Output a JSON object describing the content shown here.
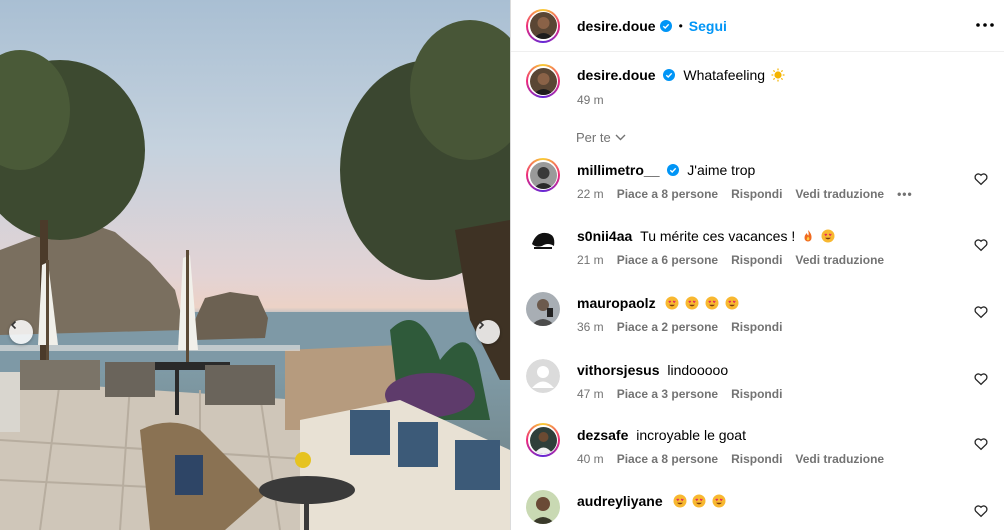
{
  "post": {
    "author": "desire.doue",
    "follow_label": "Segui",
    "separator": "•",
    "caption_text": "Whatafeeling",
    "caption_emoji": "sun-icon",
    "caption_time": "49 m"
  },
  "filter_label": "Per te",
  "actions": {
    "reply": "Rispondi",
    "translate": "Vedi traduzione",
    "more": "•••"
  },
  "comments": [
    {
      "user": "millimetro__",
      "verified": true,
      "text": "J'aime trop",
      "emojis": [],
      "time": "22 m",
      "likes": "Piace a 8 persone",
      "translate": true,
      "more": true
    },
    {
      "user": "s0nii4aa",
      "verified": false,
      "text": "Tu mérite ces vacances !",
      "emojis": [
        "fire-icon",
        "heart-eyes-icon"
      ],
      "time": "21 m",
      "likes": "Piace a 6 persone",
      "translate": true,
      "more": false
    },
    {
      "user": "mauropaolz",
      "verified": false,
      "text": "",
      "emojis": [
        "heart-eyes-icon",
        "heart-eyes-icon",
        "heart-eyes-icon",
        "heart-eyes-icon"
      ],
      "time": "36 m",
      "likes": "Piace a 2 persone",
      "translate": false,
      "more": false
    },
    {
      "user": "vithorsjesus",
      "verified": false,
      "text": "lindooooo",
      "emojis": [],
      "time": "47 m",
      "likes": "Piace a 3 persone",
      "translate": false,
      "more": false
    },
    {
      "user": "dezsafe",
      "verified": false,
      "text": "incroyable le goat",
      "emojis": [],
      "time": "40 m",
      "likes": "Piace a 8 persone",
      "translate": true,
      "more": false
    },
    {
      "user": "audreyliyane",
      "verified": false,
      "text": "",
      "emojis": [
        "heart-eyes-icon",
        "heart-eyes-icon",
        "heart-eyes-icon"
      ],
      "time": "",
      "likes": "",
      "translate": false,
      "more": false
    }
  ],
  "colors": {
    "accent": "#0095f6",
    "verified": "#0095f6",
    "meta": "#737373"
  }
}
